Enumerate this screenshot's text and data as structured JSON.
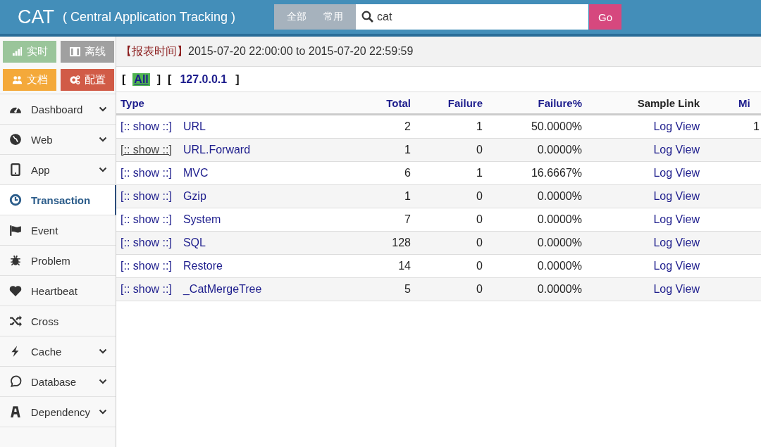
{
  "header": {
    "title": "CAT",
    "subtitle": "( Central Application Tracking )",
    "scopes": [
      {
        "label": "全部",
        "selected": false
      },
      {
        "label": "常用",
        "selected": false
      }
    ],
    "search": {
      "value": "cat"
    },
    "go_button": "Go"
  },
  "shortcuts": [
    {
      "label": "实时",
      "color": "#9ac59a"
    },
    {
      "label": "离线",
      "color": "#a0a0a0"
    },
    {
      "label": "文档",
      "color": "#f4a93a"
    },
    {
      "label": "配置",
      "color": "#d15b47"
    }
  ],
  "sidebar": {
    "items": [
      {
        "label": "Dashboard",
        "has_submenu": true,
        "selected": false
      },
      {
        "label": "Web",
        "has_submenu": true,
        "selected": false
      },
      {
        "label": "App",
        "has_submenu": true,
        "selected": false
      },
      {
        "label": "Transaction",
        "has_submenu": false,
        "selected": true
      },
      {
        "label": "Event",
        "has_submenu": false,
        "selected": false
      },
      {
        "label": "Problem",
        "has_submenu": false,
        "selected": false
      },
      {
        "label": "Heartbeat",
        "has_submenu": false,
        "selected": false
      },
      {
        "label": "Cross",
        "has_submenu": false,
        "selected": false
      },
      {
        "label": "Cache",
        "has_submenu": true,
        "selected": false
      },
      {
        "label": "Database",
        "has_submenu": true,
        "selected": false
      },
      {
        "label": "Dependency",
        "has_submenu": true,
        "selected": false
      }
    ]
  },
  "report_time": {
    "label": "【报表时间】",
    "range": "2015-07-20 22:00:00 to 2015-07-20 22:59:59"
  },
  "ip_filters": [
    {
      "open": "[",
      "label": "All",
      "close": "]",
      "selected": true
    },
    {
      "open": "[",
      "label": "127.0.0.1",
      "close": "]",
      "selected": false
    }
  ],
  "table": {
    "columns": [
      "Type",
      "Total",
      "Failure",
      "Failure%",
      "Sample Link",
      "Mi"
    ],
    "rows": [
      {
        "show": "[:: show ::]",
        "hovered": false,
        "type": "URL",
        "total": "2",
        "failure": "1",
        "failure_pct": "50.0000%",
        "link": "Log View",
        "column_6": "1"
      },
      {
        "show": "[:: show ::]",
        "hovered": true,
        "type": "URL.Forward",
        "total": "1",
        "failure": "0",
        "failure_pct": "0.0000%",
        "link": "Log View"
      },
      {
        "show": "[:: show ::]",
        "hovered": false,
        "type": "MVC",
        "total": "6",
        "failure": "1",
        "failure_pct": "16.6667%",
        "link": "Log View"
      },
      {
        "show": "[:: show ::]",
        "hovered": false,
        "type": "Gzip",
        "total": "1",
        "failure": "0",
        "failure_pct": "0.0000%",
        "link": "Log View"
      },
      {
        "show": "[:: show ::]",
        "hovered": false,
        "type": "System",
        "total": "7",
        "failure": "0",
        "failure_pct": "0.0000%",
        "link": "Log View"
      },
      {
        "show": "[:: show ::]",
        "hovered": false,
        "type": "SQL",
        "total": "128",
        "failure": "0",
        "failure_pct": "0.0000%",
        "link": "Log View"
      },
      {
        "show": "[:: show ::]",
        "hovered": false,
        "type": "Restore",
        "total": "14",
        "failure": "0",
        "failure_pct": "0.0000%",
        "link": "Log View"
      },
      {
        "show": "[:: show ::]",
        "hovered": false,
        "type": "_CatMergeTree",
        "total": "5",
        "failure": "0",
        "failure_pct": "0.0000%",
        "link": "Log View"
      }
    ]
  }
}
